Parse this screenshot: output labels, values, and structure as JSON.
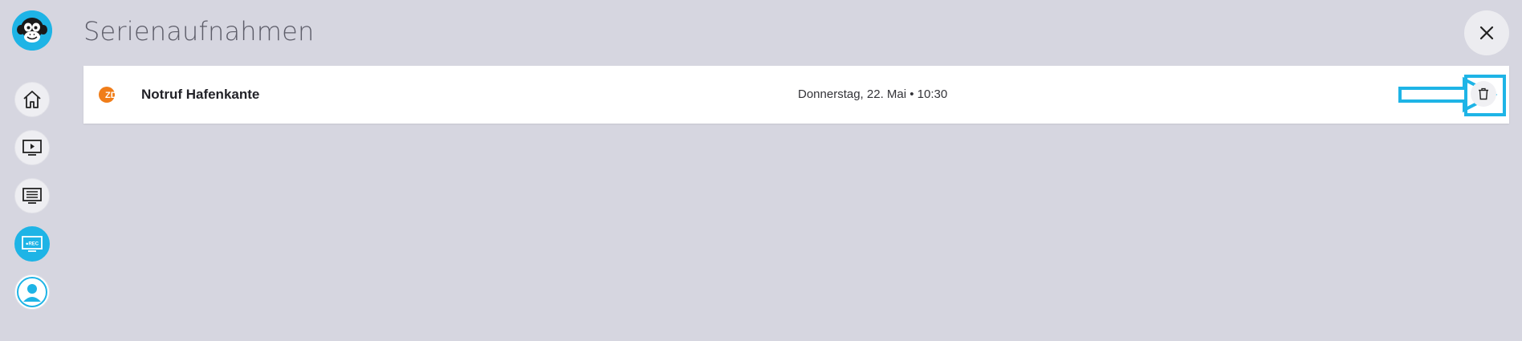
{
  "header": {
    "title": "Serienaufnahmen"
  },
  "nav": {
    "items": [
      {
        "name": "home",
        "icon": "home-icon"
      },
      {
        "name": "tv",
        "icon": "tv-play-icon"
      },
      {
        "name": "guide",
        "icon": "program-guide-icon"
      },
      {
        "name": "recordings",
        "icon": "rec-icon",
        "badge": "●REC",
        "active": true
      },
      {
        "name": "profile",
        "icon": "user-icon"
      }
    ]
  },
  "recordings": [
    {
      "channel": "ZDF",
      "channel_icon": "zdf-logo",
      "title": "Notruf Hafenkante",
      "airtime": "Donnerstag, 22. Mai • 10:30"
    }
  ],
  "colors": {
    "accent": "#1eb4e6",
    "background": "#d6d6e0",
    "zdf_orange": "#f07d19"
  }
}
